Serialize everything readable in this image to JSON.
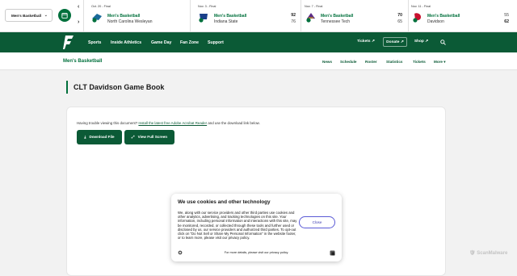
{
  "scorebar": {
    "sport_select": "Men's Basketball",
    "prev_label": "‹",
    "next_label": "›",
    "games": [
      {
        "status": "Oct. 20 - Final",
        "sport": "Men's Basketball",
        "opponent": "North Carolina Wesleyan",
        "home_score": "",
        "away_score": "",
        "opp_color": "#1a6a9a"
      },
      {
        "status": "Nov. 3 - Final",
        "sport": "Men's Basketball",
        "opponent": "Indiana State",
        "home_score": "92",
        "away_score": "76",
        "opp_color": "#1a3f8a"
      },
      {
        "status": "Nov. 7 - Final",
        "sport": "Men's Basketball",
        "opponent": "Tennessee Tech",
        "home_score": "70",
        "away_score": "65",
        "opp_color": "#5b2a86"
      },
      {
        "status": "Nov. 11 - Final",
        "sport": "Men's Basketball",
        "opponent": "Davidson",
        "home_score": "55",
        "away_score": "62",
        "opp_color": "#c8102e"
      }
    ]
  },
  "nav": {
    "items": [
      "Sports",
      "Inside Athletics",
      "Game Day",
      "Fan Zone",
      "Support"
    ],
    "tickets": "Tickets",
    "donate": "Donate",
    "shop": "Shop"
  },
  "subnav": {
    "title": "Men's Basketball",
    "links": [
      "News",
      "Schedule",
      "Roster",
      "Statistics",
      "Tickets",
      "More"
    ]
  },
  "page": {
    "title": "CLT Davidson Game Book",
    "hint_prefix": "Having trouble viewing this document?",
    "hint_link": "Install the latest free Adobe Acrobat Reader",
    "hint_suffix": "and use the download link below.",
    "download_label": "Download File",
    "fullscreen_label": "View Full Screen"
  },
  "cookie": {
    "title": "We use cookies and other technology",
    "body": "We, along with our service providers and other third parties use cookies and other analytics, advertising, and tracking technologies on this site. Your information, including personal information and interactions with this site, may be monitored, recorded, or collected through these tools and further used or disclosed by us, our service providers and authorized third parties. To opt-out click on \"Do Not Sell or Share My Personal Information\" in the website footer, or to learn more, please visit our privacy policy.",
    "close_label": "Close",
    "footer": "For more details, please visit our privacy policy."
  },
  "watermark": "ScanMalware",
  "colors": {
    "brand_green": "#0b5a36",
    "accent_green": "#00703c"
  }
}
